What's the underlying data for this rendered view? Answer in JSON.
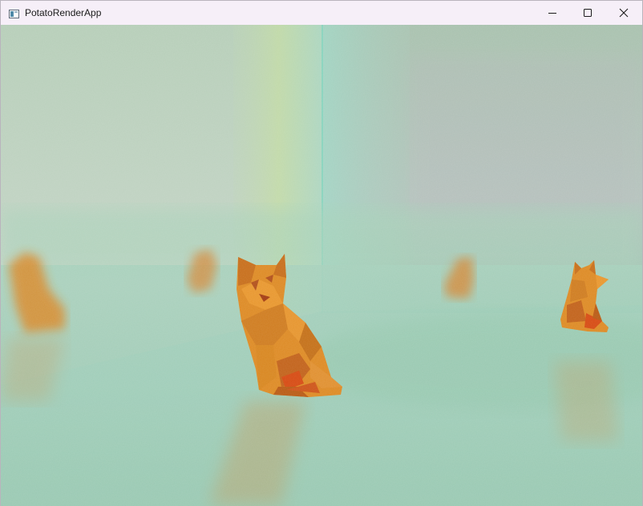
{
  "window": {
    "title": "PotatoRenderApp",
    "app_icon": "window-app-icon",
    "controls": {
      "minimize_icon": "minimize-icon",
      "maximize_icon": "maximize-icon",
      "close_icon": "close-icon"
    }
  },
  "scene": {
    "colors": {
      "wall_left": "#b9d1bb",
      "wall_right": "#a9c2b3",
      "wall_center": "#9fd1c0",
      "floor": "#9cc9b2",
      "cat_orange": "#e08a23",
      "cat_shadow": "#b95a14",
      "cat_red": "#d64a12"
    }
  }
}
